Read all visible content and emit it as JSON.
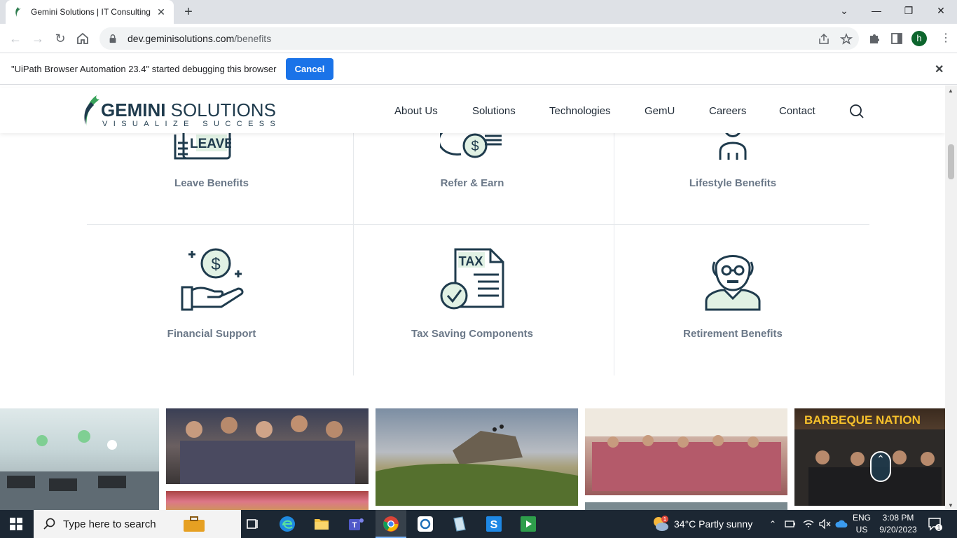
{
  "browser": {
    "tab_title": "Gemini Solutions | IT Consulting",
    "url_domain": "dev.geminisolutions.com",
    "url_path": "/benefits",
    "profile_initial": "h"
  },
  "infobar": {
    "message": "\"UiPath Browser Automation 23.4\" started debugging this browser",
    "cancel_label": "Cancel"
  },
  "site": {
    "logo_name_bold": "GEMINI",
    "logo_name_rest": " SOLUTIONS",
    "logo_tagline": "VISUALIZE SUCCESS",
    "nav": [
      "About Us",
      "Solutions",
      "Technologies",
      "GemU",
      "Careers",
      "Contact"
    ],
    "brand_color": "#1f3b4d",
    "accent_green": "#3aa35b"
  },
  "benefits": {
    "row1": [
      "Leave Benefits",
      "Refer & Earn",
      "Lifestyle Benefits"
    ],
    "row2": [
      "Financial Support",
      "Tax Saving Components",
      "Retirement Benefits"
    ],
    "leave_icon_text": "LEAVE",
    "tax_icon_text": "TAX",
    "sign_text": "BARBEQUE NATION"
  },
  "taskbar": {
    "search_placeholder": "Type here to search",
    "weather": "34°C  Partly sunny",
    "weather_badge": "1",
    "lang_top": "ENG",
    "lang_bottom": "US",
    "time": "3:08 PM",
    "date": "9/20/2023",
    "notification_count": "1"
  }
}
